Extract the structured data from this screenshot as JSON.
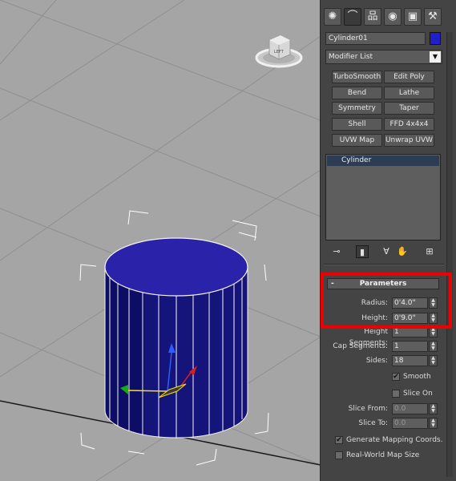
{
  "viewport": {
    "viewcube_label": "LEFT",
    "cylinder_color": "#1f1f9e",
    "selection_bracket_color": "#ffffff"
  },
  "command_panel": {
    "tabs": [
      {
        "icon": "create-icon",
        "glyph": "✺"
      },
      {
        "icon": "modify-icon",
        "glyph": "⌒"
      },
      {
        "icon": "hierarchy-icon",
        "glyph": "品"
      },
      {
        "icon": "motion-icon",
        "glyph": "◉"
      },
      {
        "icon": "display-icon",
        "glyph": "▣"
      },
      {
        "icon": "utilities-icon",
        "glyph": "⚒"
      }
    ],
    "object_name": "Cylinder01",
    "object_color": "#2120c8",
    "modifier_list": "Modifier List",
    "modifier_buttons": [
      "TurboSmooth",
      "Edit Poly",
      "Bend",
      "Lathe",
      "Symmetry",
      "Taper",
      "Shell",
      "FFD 4x4x4",
      "UVW Map",
      "Unwrap UVW"
    ],
    "stack_items": [
      "Cylinder"
    ],
    "parameters": {
      "title": "Parameters",
      "collapse_glyph": "-",
      "radius_label": "Radius:",
      "radius_value": "0'4.0\"",
      "height_label": "Height:",
      "height_value": "0'9.0\"",
      "height_segments_label": "Height Segments:",
      "height_segments_value": "1",
      "cap_segments_label": "Cap Segments:",
      "cap_segments_value": "1",
      "sides_label": "Sides:",
      "sides_value": "18",
      "smooth_label": "Smooth",
      "smooth_checked": true,
      "slice_on_label": "Slice On",
      "slice_on_checked": false,
      "slice_from_label": "Slice From:",
      "slice_from_value": "0.0",
      "slice_to_label": "Slice To:",
      "slice_to_value": "0.0",
      "gen_mapping_label": "Generate Mapping Coords.",
      "gen_mapping_checked": true,
      "real_world_label": "Real-World Map Size",
      "real_world_checked": false
    },
    "highlight_color": "#ee0000"
  }
}
